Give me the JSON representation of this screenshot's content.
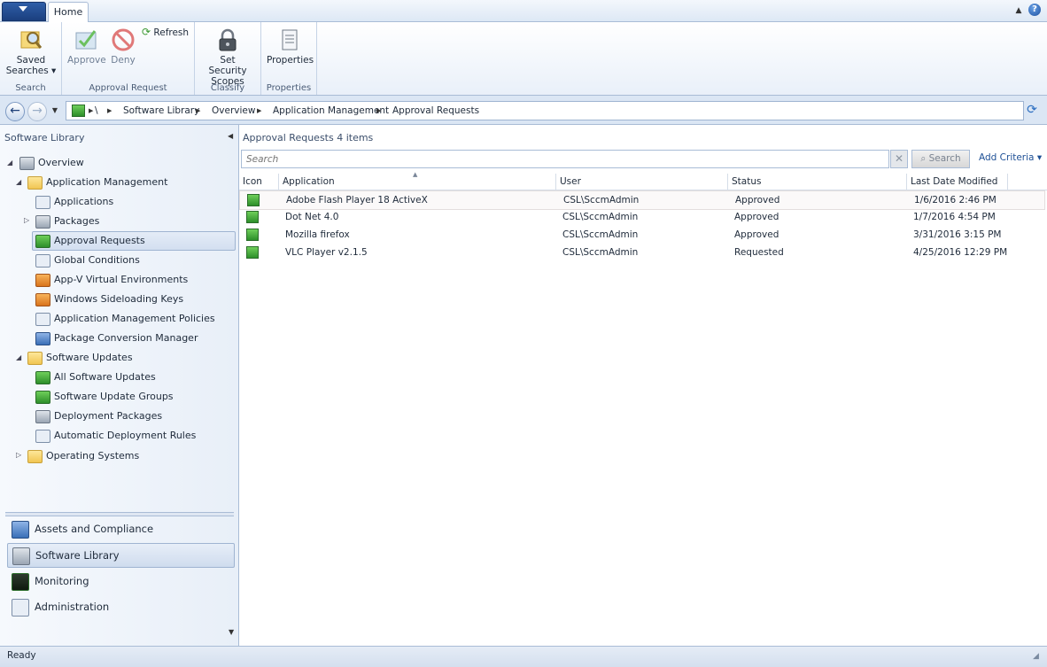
{
  "tabs": {
    "home": "Home"
  },
  "ribbon": {
    "saved_searches": "Saved Searches ▾",
    "approve": "Approve",
    "deny": "Deny",
    "refresh": "Refresh",
    "set_security_scopes": "Set Security Scopes",
    "properties": "Properties",
    "groups": {
      "search": "Search",
      "approval_request": "Approval Request",
      "classify": "Classify",
      "properties": "Properties"
    }
  },
  "breadcrumb": {
    "root": "\\",
    "items": [
      "Software Library",
      "Overview",
      "Application Management",
      "Approval Requests"
    ]
  },
  "sidebar": {
    "title": "Software Library",
    "tree": [
      {
        "label": "Overview"
      },
      {
        "label": "Application Management"
      },
      {
        "label": "Applications"
      },
      {
        "label": "Packages"
      },
      {
        "label": "Approval Requests"
      },
      {
        "label": "Global Conditions"
      },
      {
        "label": "App-V Virtual Environments"
      },
      {
        "label": "Windows Sideloading Keys"
      },
      {
        "label": "Application Management Policies"
      },
      {
        "label": "Package Conversion Manager"
      },
      {
        "label": "Software Updates"
      },
      {
        "label": "All Software Updates"
      },
      {
        "label": "Software Update Groups"
      },
      {
        "label": "Deployment Packages"
      },
      {
        "label": "Automatic Deployment Rules"
      },
      {
        "label": "Operating Systems"
      }
    ],
    "workspaces": [
      "Assets and Compliance",
      "Software Library",
      "Monitoring",
      "Administration"
    ]
  },
  "main": {
    "title": "Approval Requests 4 items",
    "search_placeholder": "Search",
    "search_button": "Search",
    "add_criteria": "Add Criteria ▾",
    "columns": [
      "Icon",
      "Application",
      "User",
      "Status",
      "Last Date Modified"
    ],
    "rows": [
      {
        "application": "Adobe Flash Player 18 ActiveX",
        "user": "CSL\\SccmAdmin",
        "status": "Approved",
        "modified": "1/6/2016 2:46 PM"
      },
      {
        "application": "Dot Net 4.0",
        "user": "CSL\\SccmAdmin",
        "status": "Approved",
        "modified": "1/7/2016 4:54 PM"
      },
      {
        "application": "Mozilla firefox",
        "user": "CSL\\SccmAdmin",
        "status": "Approved",
        "modified": "3/31/2016 3:15 PM"
      },
      {
        "application": "VLC Player v2.1.5",
        "user": "CSL\\SccmAdmin",
        "status": "Requested",
        "modified": "4/25/2016 12:29 PM"
      }
    ]
  },
  "status_bar": {
    "text": "Ready"
  }
}
